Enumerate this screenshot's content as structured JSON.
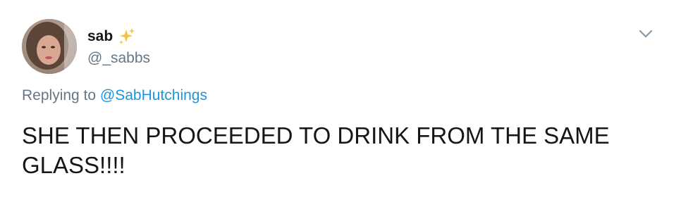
{
  "user": {
    "display_name": "sab",
    "handle": "@_sabbs",
    "avatar_icon": "profile-photo",
    "badge_icon": "sparkles-emoji"
  },
  "reply": {
    "prefix": "Replying to",
    "mention": "@SabHutchings"
  },
  "tweet": {
    "text": "SHE THEN PROCEEDED TO DRINK FROM THE SAME GLASS!!!!"
  },
  "menu": {
    "icon": "chevron-down-icon"
  },
  "colors": {
    "text": "#14171a",
    "secondary": "#657786",
    "link": "#1b95e0",
    "sparkle": "#f5c33b"
  }
}
